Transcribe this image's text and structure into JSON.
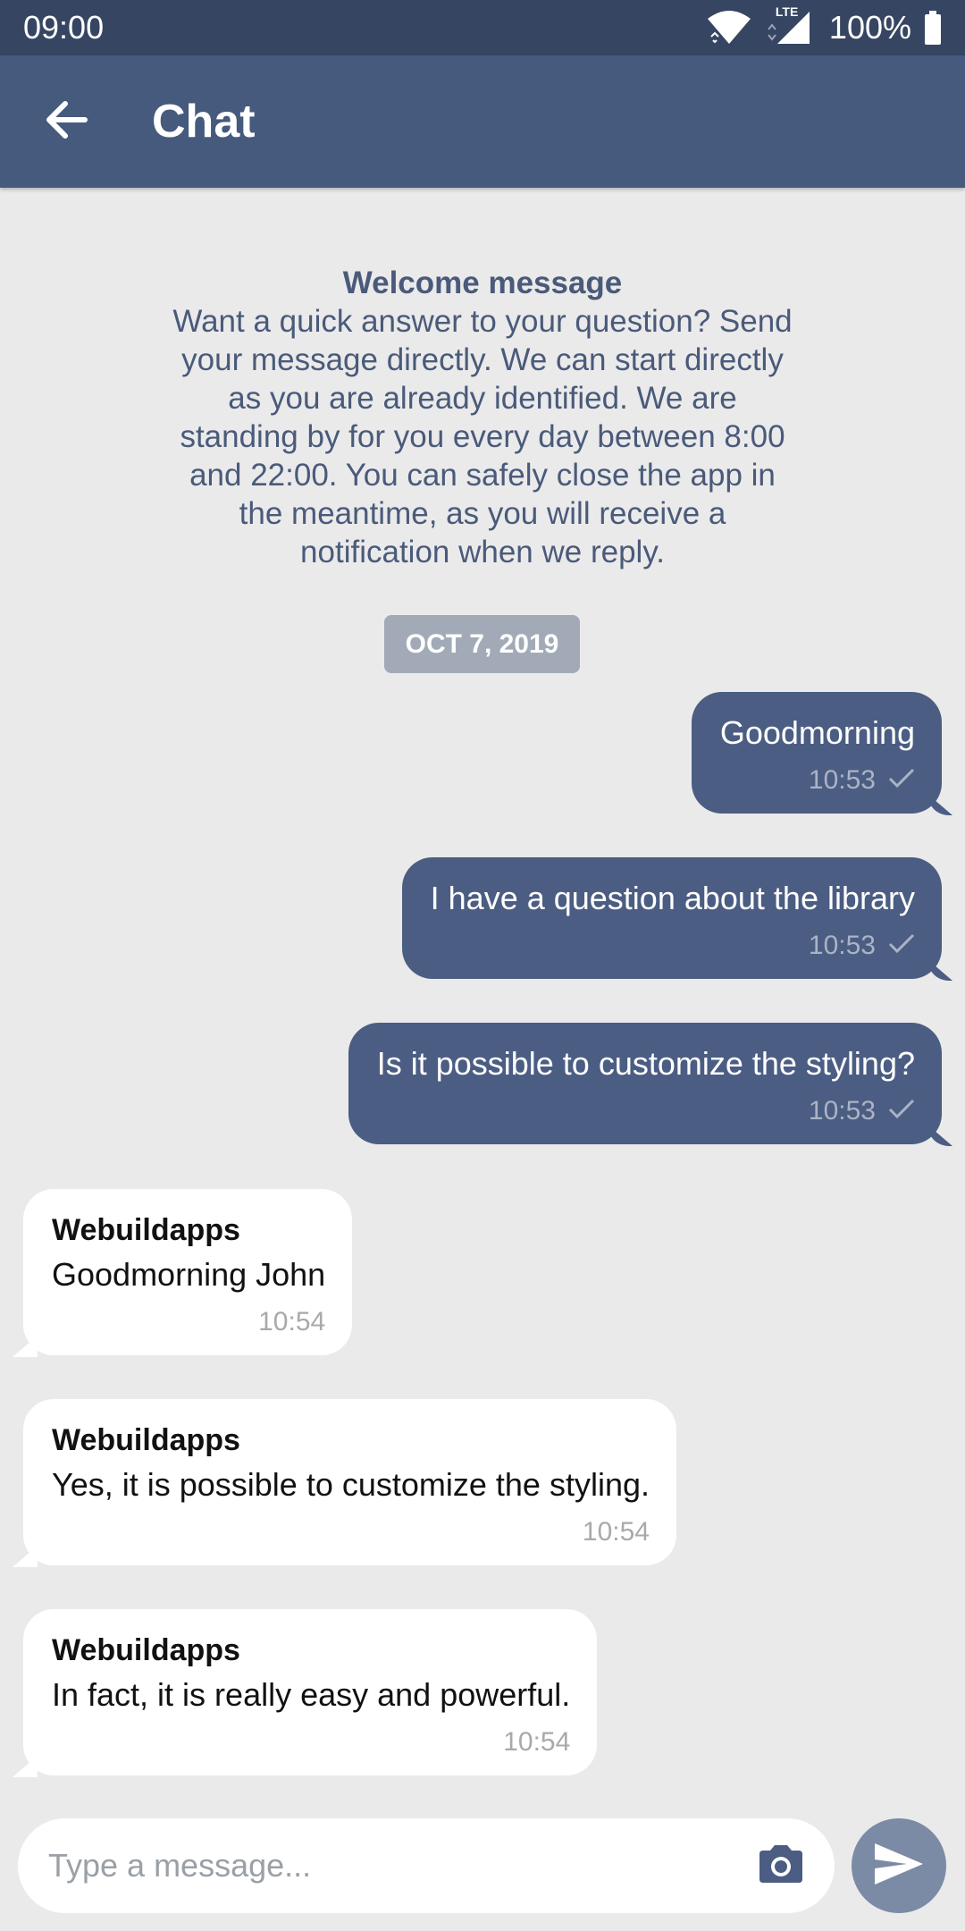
{
  "status_bar": {
    "time": "09:00",
    "network": "LTE",
    "battery": "100%"
  },
  "app_bar": {
    "title": "Chat"
  },
  "welcome": {
    "title": "Welcome message",
    "body": "Want a quick answer to your question? Send your message directly. We can start directly as you are already identified. We are standing by for you every day between 8:00 and 22:00. You can safely close the app in the meantime, as you will receive a notification when we reply."
  },
  "date_chip": "OCT 7, 2019",
  "messages": [
    {
      "direction": "out",
      "text": "Goodmorning",
      "time": "10:53",
      "status": "sent"
    },
    {
      "direction": "out",
      "text": "I have a question about the library",
      "time": "10:53",
      "status": "sent"
    },
    {
      "direction": "out",
      "text": "Is it possible to customize the styling?",
      "time": "10:53",
      "status": "sent"
    },
    {
      "direction": "in",
      "sender": "Webuildapps",
      "text": "Goodmorning John",
      "time": "10:54"
    },
    {
      "direction": "in",
      "sender": "Webuildapps",
      "text": "Yes, it is possible to customize the styling.",
      "time": "10:54"
    },
    {
      "direction": "in",
      "sender": "Webuildapps",
      "text": "In fact, it is really easy and powerful.",
      "time": "10:54"
    }
  ],
  "composer": {
    "placeholder": "Type a message..."
  },
  "colors": {
    "status_bar": "#364562",
    "app_bar": "#455a7d",
    "outgoing_bubble": "#4b5d82",
    "incoming_bubble": "#ffffff",
    "background": "#eaeaea",
    "send_button": "#7b8aa5"
  },
  "icons": {
    "back": "arrow-left-icon",
    "wifi": "wifi-icon",
    "signal": "signal-icon",
    "battery": "battery-icon",
    "check": "check-icon",
    "camera": "camera-icon",
    "send": "send-icon"
  }
}
